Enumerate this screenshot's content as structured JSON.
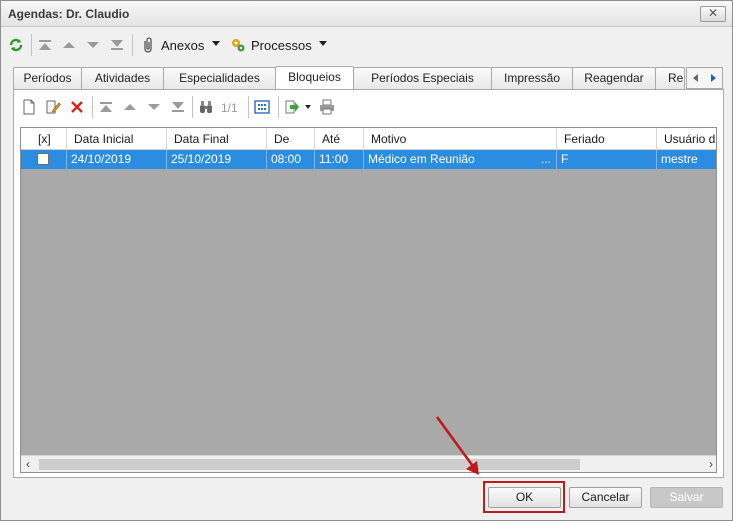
{
  "window": {
    "title": "Agendas: Dr. Claudio",
    "close_label": "✕"
  },
  "toolbar": {
    "attachments_label": "Anexos",
    "processes_label": "Processos"
  },
  "tabs": [
    {
      "label": "Períodos"
    },
    {
      "label": "Atividades"
    },
    {
      "label": "Especialidades"
    },
    {
      "label": "Bloqueios"
    },
    {
      "label": "Períodos Especiais"
    },
    {
      "label": "Impressão"
    },
    {
      "label": "Reagendar"
    },
    {
      "label": "Re"
    }
  ],
  "grid_toolbar": {
    "record_counter": "1/1"
  },
  "grid": {
    "columns": [
      "[x]",
      "Data Inicial",
      "Data Final",
      "De",
      "Até",
      "Motivo",
      "Feriado",
      "Usuário da"
    ],
    "rows": [
      {
        "checked": false,
        "data_inicial": "24/10/2019",
        "data_final": "25/10/2019",
        "de": "08:00",
        "ate": "11:00",
        "motivo": "Médico em Reunião",
        "motivo_more": "...",
        "feriado": "F",
        "usuario": "mestre"
      }
    ]
  },
  "buttons": {
    "ok": "OK",
    "cancel": "Cancelar",
    "save": "Salvar"
  },
  "colors": {
    "selection": "#2c8ce0",
    "highlight": "#c21a1a"
  }
}
